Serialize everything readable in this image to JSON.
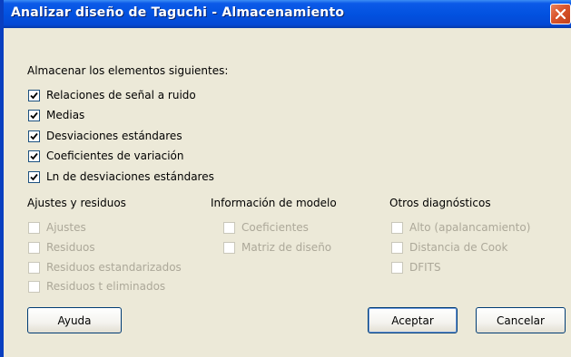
{
  "window": {
    "title": "Analizar diseño de Taguchi - Almacenamiento",
    "close_icon": "close-icon"
  },
  "store_section": {
    "label": "Almacenar los elementos siguientes:",
    "items": [
      {
        "label": "Relaciones de señal a ruido",
        "checked": true,
        "enabled": true
      },
      {
        "label": "Medias",
        "checked": true,
        "enabled": true
      },
      {
        "label": "Desviaciones estándares",
        "checked": true,
        "enabled": true
      },
      {
        "label": "Coeficientes de variación",
        "checked": true,
        "enabled": true
      },
      {
        "label": "Ln de desviaciones estándares",
        "checked": true,
        "enabled": true
      }
    ]
  },
  "fits_section": {
    "label": "Ajustes y residuos",
    "items": [
      {
        "label": "Ajustes",
        "checked": false,
        "enabled": false
      },
      {
        "label": "Residuos",
        "checked": false,
        "enabled": false
      },
      {
        "label": "Residuos estandarizados",
        "checked": false,
        "enabled": false
      },
      {
        "label": "Residuos t eliminados",
        "checked": false,
        "enabled": false
      }
    ]
  },
  "model_section": {
    "label": "Información de modelo",
    "items": [
      {
        "label": "Coeficientes",
        "checked": false,
        "enabled": false
      },
      {
        "label": "Matriz de diseño",
        "checked": false,
        "enabled": false
      }
    ]
  },
  "diagnostics_section": {
    "label": "Otros diagnósticos",
    "items": [
      {
        "label": "Alto (apalancamiento)",
        "checked": false,
        "enabled": false
      },
      {
        "label": "Distancia de Cook",
        "checked": false,
        "enabled": false
      },
      {
        "label": "DFITS",
        "checked": false,
        "enabled": false
      }
    ]
  },
  "buttons": {
    "help": "Ayuda",
    "ok": "Aceptar",
    "cancel": "Cancelar"
  },
  "colors": {
    "titlebar": "#0252e0",
    "dialog_background": "#ece9d8",
    "disabled_text": "#aca899",
    "close_button": "#d9542b"
  }
}
